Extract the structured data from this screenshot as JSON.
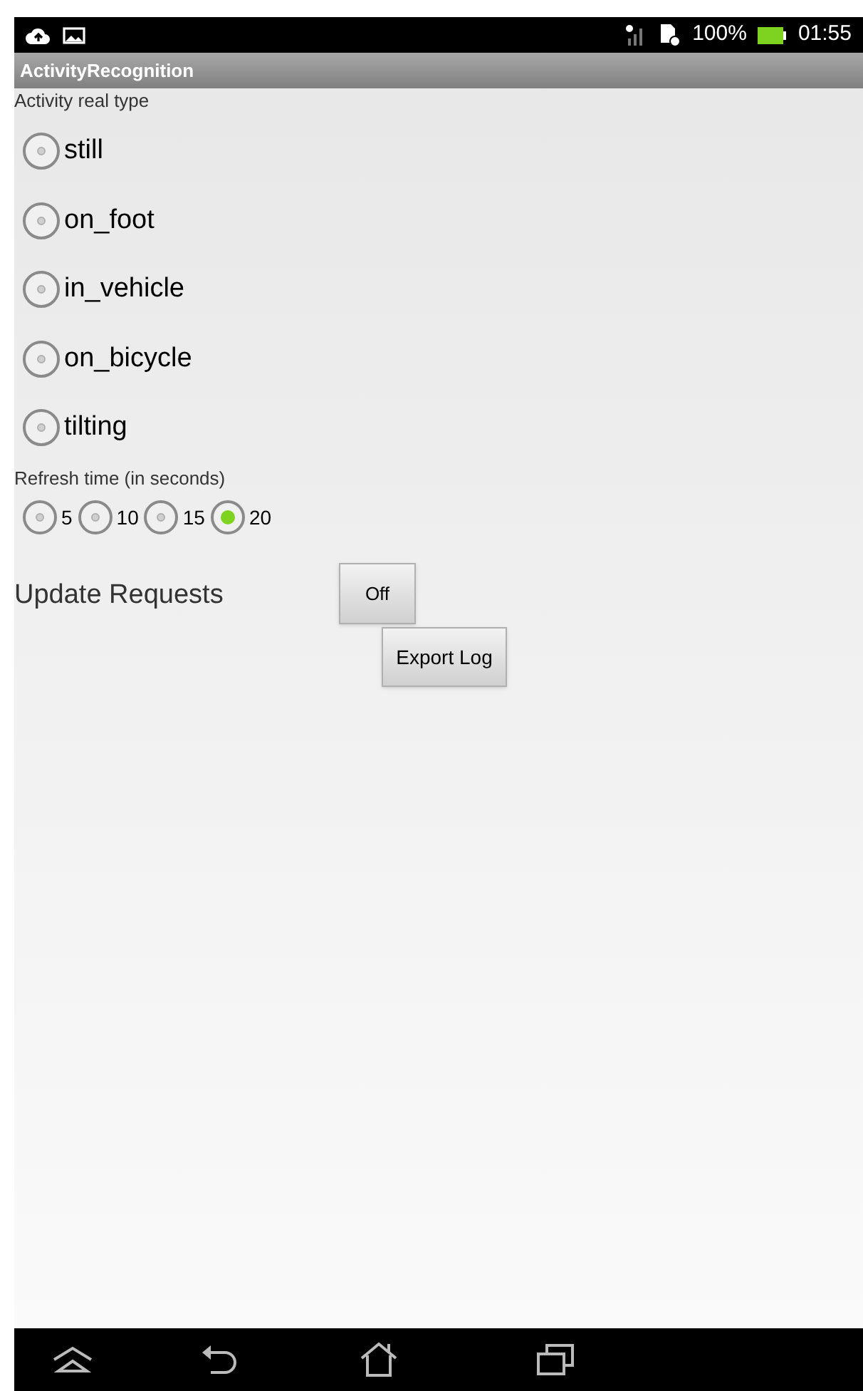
{
  "status_bar": {
    "battery": "100%",
    "time": "01:55"
  },
  "title_bar": {
    "title": "ActivityRecognition"
  },
  "activity_section": {
    "label": "Activity real type",
    "options": [
      {
        "label": "still",
        "selected": false
      },
      {
        "label": "on_foot",
        "selected": false
      },
      {
        "label": "in_vehicle",
        "selected": false
      },
      {
        "label": "on_bicycle",
        "selected": false
      },
      {
        "label": "tilting",
        "selected": false
      }
    ]
  },
  "refresh_section": {
    "label": "Refresh time (in seconds)",
    "options": [
      {
        "label": "5",
        "selected": false
      },
      {
        "label": "10",
        "selected": false
      },
      {
        "label": "15",
        "selected": false
      },
      {
        "label": "20",
        "selected": true
      }
    ]
  },
  "update_requests": {
    "label": "Update Requests",
    "button": "Off"
  },
  "export_button": "Export Log"
}
